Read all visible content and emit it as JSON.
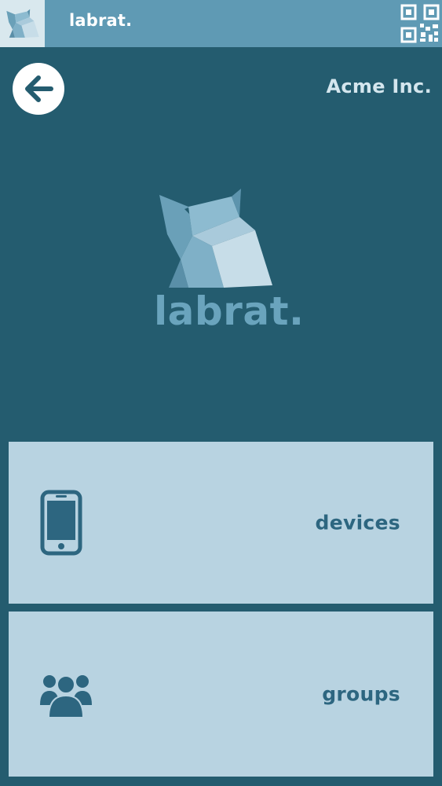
{
  "topbar": {
    "app_title": "labrat.",
    "logo_icon": "labrat-logo-icon",
    "qr_icon": "qr-code-icon"
  },
  "header": {
    "back_icon": "arrow-left-icon",
    "company": "Acme Inc."
  },
  "brand": {
    "name": "labrat."
  },
  "menu": {
    "items": [
      {
        "label": "devices",
        "icon": "smartphone-icon"
      },
      {
        "label": "groups",
        "icon": "users-group-icon"
      }
    ]
  },
  "colors": {
    "background": "#245c6f",
    "topbar": "#5f9ab4",
    "tile": "#b8d3e1",
    "tile_text": "#2d6680",
    "brand_text": "#6aa4bd"
  }
}
